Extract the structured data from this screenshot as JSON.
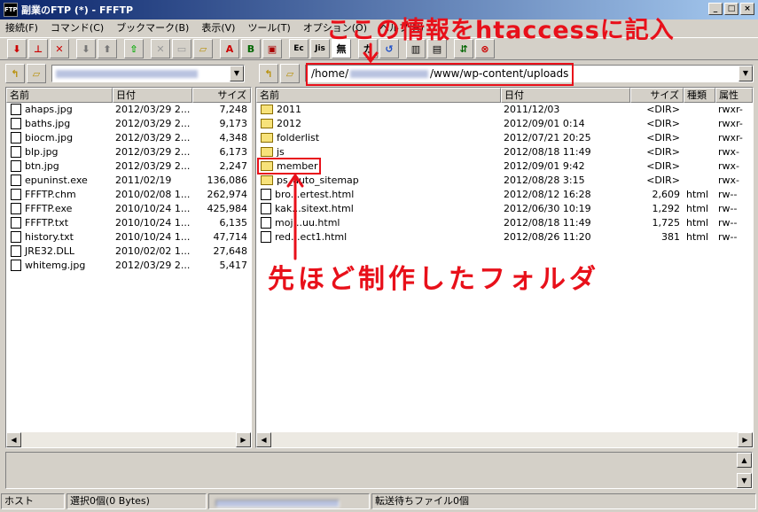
{
  "window": {
    "title": "副業のFTP (*) - FFFTP",
    "app_icon": "FTP"
  },
  "menu": [
    "接続(F)",
    "コマンド(C)",
    "ブックマーク(B)",
    "表示(V)",
    "ツール(T)",
    "オプション(O)",
    "ヘルプ(H)"
  ],
  "toolbar": {
    "text_buttons": [
      "A",
      "B",
      "Ec",
      "Jis",
      "無",
      "カ"
    ]
  },
  "local": {
    "columns": [
      "名前",
      "日付",
      "サイズ"
    ],
    "files": [
      {
        "name": "ahaps.jpg",
        "date": "2012/03/29 2...",
        "size": "7,248"
      },
      {
        "name": "baths.jpg",
        "date": "2012/03/29 2...",
        "size": "9,173"
      },
      {
        "name": "biocm.jpg",
        "date": "2012/03/29 2...",
        "size": "4,348"
      },
      {
        "name": "blp.jpg",
        "date": "2012/03/29 2...",
        "size": "6,173"
      },
      {
        "name": "btn.jpg",
        "date": "2012/03/29 2...",
        "size": "2,247"
      },
      {
        "name": "epuninst.exe",
        "date": "2011/02/19",
        "size": "136,086"
      },
      {
        "name": "FFFTP.chm",
        "date": "2010/02/08 1...",
        "size": "262,974"
      },
      {
        "name": "FFFTP.exe",
        "date": "2010/10/24 1...",
        "size": "425,984"
      },
      {
        "name": "FFFTP.txt",
        "date": "2010/10/24 1...",
        "size": "6,135"
      },
      {
        "name": "history.txt",
        "date": "2010/10/24 1...",
        "size": "47,714"
      },
      {
        "name": "JRE32.DLL",
        "date": "2010/02/02 1...",
        "size": "27,648"
      },
      {
        "name": "whitemg.jpg",
        "date": "2012/03/29 2...",
        "size": "5,417"
      }
    ]
  },
  "remote": {
    "path": "/home/",
    "path_suffix": "/www/wp-content/uploads",
    "columns": [
      "名前",
      "日付",
      "サイズ",
      "種類",
      "属性"
    ],
    "files": [
      {
        "name": "2011",
        "date": "2011/12/03",
        "size": "<DIR>",
        "type": "",
        "attr": "rwxr-",
        "folder": true
      },
      {
        "name": "2012",
        "date": "2012/09/01 0:14",
        "size": "<DIR>",
        "type": "",
        "attr": "rwxr-",
        "folder": true
      },
      {
        "name": "folderlist",
        "date": "2012/07/21 20:25",
        "size": "<DIR>",
        "type": "",
        "attr": "rwxr-",
        "folder": true
      },
      {
        "name": "js",
        "date": "2012/08/18 11:49",
        "size": "<DIR>",
        "type": "",
        "attr": "rwx-",
        "folder": true
      },
      {
        "name": "member",
        "date": "2012/09/01 9:42",
        "size": "<DIR>",
        "type": "",
        "attr": "rwx-",
        "folder": true
      },
      {
        "name": "ps_auto_sitemap",
        "date": "2012/08/28 3:15",
        "size": "<DIR>",
        "type": "",
        "attr": "rwx-",
        "folder": true
      },
      {
        "name": "bro...ertest.html",
        "date": "2012/08/12 16:28",
        "size": "2,609",
        "type": "html",
        "attr": "rw--",
        "folder": false
      },
      {
        "name": "kak...sitext.html",
        "date": "2012/06/30 10:19",
        "size": "1,292",
        "type": "html",
        "attr": "rw--",
        "folder": false
      },
      {
        "name": "moj...uu.html",
        "date": "2012/08/18 11:49",
        "size": "1,725",
        "type": "html",
        "attr": "rw--",
        "folder": false
      },
      {
        "name": "red...ect1.html",
        "date": "2012/08/26 11:20",
        "size": "381",
        "type": "html",
        "attr": "rw--",
        "folder": false
      }
    ]
  },
  "status": {
    "host": "ホスト",
    "selected": "選択0個(0 Bytes)",
    "queue": "転送待ちファイル0個"
  },
  "annotations": {
    "top": "ここの情報をhtaccessに記入",
    "middle": "先ほど制作したフォルダ"
  },
  "colors": {
    "annotation": "#e8101a",
    "titlebar": "#0a246a"
  }
}
